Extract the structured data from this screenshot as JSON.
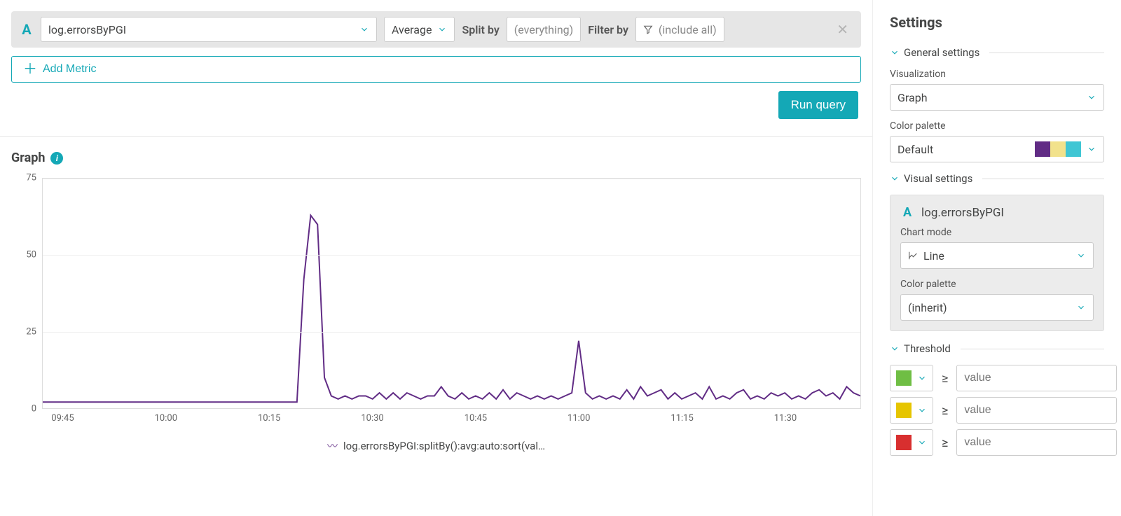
{
  "query": {
    "letter": "A",
    "metric": "log.errorsByPGI",
    "aggregation": "Average",
    "split_by_label": "Split by",
    "split_by_placeholder": "(everything)",
    "filter_by_label": "Filter by",
    "filter_placeholder": "(include all)"
  },
  "buttons": {
    "add_metric": "Add Metric",
    "run_query": "Run query"
  },
  "graph": {
    "title": "Graph",
    "legend": "log.errorsByPGI:splitBy():avg:auto:sort(val…"
  },
  "settings": {
    "title": "Settings",
    "general": {
      "label": "General settings",
      "visualization_label": "Visualization",
      "visualization_value": "Graph",
      "palette_label": "Color palette",
      "palette_value": "Default"
    },
    "visual": {
      "label": "Visual settings",
      "metric_letter": "A",
      "metric_name": "log.errorsByPGI",
      "chart_mode_label": "Chart mode",
      "chart_mode_value": "Line",
      "palette_label": "Color palette",
      "palette_value": "(inherit)"
    },
    "threshold": {
      "label": "Threshold",
      "rows": [
        {
          "color": "#6fbe44",
          "op": "≥",
          "placeholder": "value"
        },
        {
          "color": "#e6c500",
          "op": "≥",
          "placeholder": "value"
        },
        {
          "color": "#d82f2f",
          "op": "≥",
          "placeholder": "value"
        }
      ]
    },
    "palette_colors": [
      "#612c85",
      "#f2e28c",
      "#3fc6d4"
    ]
  },
  "chart_data": {
    "type": "line",
    "title": "Graph",
    "xlabel": "",
    "ylabel": "",
    "ylim": [
      0,
      75
    ],
    "x_ticks": [
      "09:45",
      "10:00",
      "10:15",
      "10:30",
      "10:45",
      "11:00",
      "11:15",
      "11:30"
    ],
    "series": [
      {
        "name": "log.errorsByPGI:splitBy():avg:auto:sort(val…)",
        "color": "#612c85",
        "x": [
          "09:42",
          "09:43",
          "09:44",
          "09:45",
          "09:46",
          "09:47",
          "09:48",
          "09:49",
          "09:50",
          "09:51",
          "09:52",
          "09:53",
          "09:54",
          "09:55",
          "09:56",
          "09:57",
          "09:58",
          "09:59",
          "10:00",
          "10:01",
          "10:02",
          "10:03",
          "10:04",
          "10:05",
          "10:06",
          "10:07",
          "10:08",
          "10:09",
          "10:10",
          "10:11",
          "10:12",
          "10:13",
          "10:14",
          "10:15",
          "10:16",
          "10:17",
          "10:18",
          "10:19",
          "10:20",
          "10:21",
          "10:22",
          "10:23",
          "10:24",
          "10:25",
          "10:26",
          "10:27",
          "10:28",
          "10:29",
          "10:30",
          "10:31",
          "10:32",
          "10:33",
          "10:34",
          "10:35",
          "10:36",
          "10:37",
          "10:38",
          "10:39",
          "10:40",
          "10:41",
          "10:42",
          "10:43",
          "10:44",
          "10:45",
          "10:46",
          "10:47",
          "10:48",
          "10:49",
          "10:50",
          "10:51",
          "10:52",
          "10:53",
          "10:54",
          "10:55",
          "10:56",
          "10:57",
          "10:58",
          "10:59",
          "11:00",
          "11:01",
          "11:02",
          "11:03",
          "11:04",
          "11:05",
          "11:06",
          "11:07",
          "11:08",
          "11:09",
          "11:10",
          "11:11",
          "11:12",
          "11:13",
          "11:14",
          "11:15",
          "11:16",
          "11:17",
          "11:18",
          "11:19",
          "11:20",
          "11:21",
          "11:22",
          "11:23",
          "11:24",
          "11:25",
          "11:26",
          "11:27",
          "11:28",
          "11:29",
          "11:30",
          "11:31",
          "11:32",
          "11:33",
          "11:34",
          "11:35",
          "11:36",
          "11:37",
          "11:38",
          "11:39",
          "11:40",
          "11:41"
        ],
        "values": [
          2,
          2,
          2,
          2,
          2,
          2,
          2,
          2,
          2,
          2,
          2,
          2,
          2,
          2,
          2,
          2,
          2,
          2,
          2,
          2,
          2,
          2,
          2,
          2,
          2,
          2,
          2,
          2,
          2,
          2,
          2,
          2,
          2,
          2,
          2,
          2,
          2,
          2,
          42,
          63,
          60,
          10,
          4,
          3,
          4,
          3,
          4,
          4,
          3,
          5,
          3,
          5,
          3,
          5,
          4,
          3,
          4,
          4,
          7,
          4,
          3,
          5,
          3,
          4,
          3,
          5,
          3,
          6,
          3,
          5,
          4,
          3,
          4,
          3,
          4,
          3,
          4,
          5,
          22,
          5,
          3,
          4,
          3,
          4,
          3,
          6,
          3,
          7,
          4,
          5,
          6,
          3,
          5,
          3,
          4,
          5,
          3,
          7,
          3,
          4,
          3,
          5,
          6,
          3,
          4,
          3,
          5,
          4,
          5,
          3,
          4,
          3,
          5,
          6,
          4,
          5,
          3,
          7,
          5,
          4
        ]
      }
    ]
  }
}
